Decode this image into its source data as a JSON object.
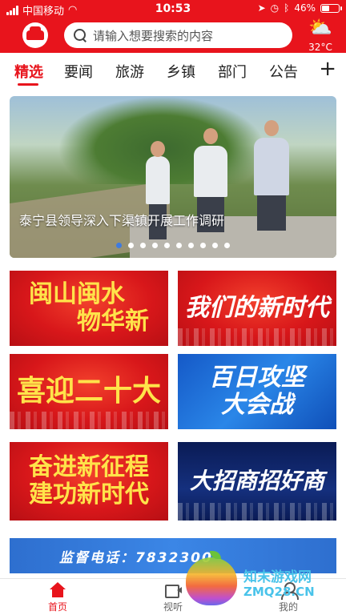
{
  "status_bar": {
    "carrier": "中国移动",
    "time": "10:53",
    "battery": "46%",
    "battery_level": 0.46
  },
  "header": {
    "search_placeholder": "请输入想要搜索的内容",
    "weather_temp": "32°C",
    "weather_icon": "partly-cloudy-icon"
  },
  "tabs": [
    "精选",
    "要闻",
    "旅游",
    "乡镇",
    "部门",
    "公告"
  ],
  "tab_plus": "+",
  "banner": {
    "caption": "泰宁县领导深入下渠镇开展工作调研",
    "dot_count": 10,
    "active_dot": 0
  },
  "tiles": [
    {
      "line1": "闽山闽水",
      "line2": "物华新"
    },
    {
      "line1": "我们的新时代",
      "line2": ""
    },
    {
      "line1": "喜迎二十大",
      "line2": ""
    },
    {
      "line1": "百日攻坚",
      "line2": "大会战"
    },
    {
      "line1": "奋进新征程",
      "line2": "建功新时代"
    },
    {
      "line1": "大招商招好商",
      "line2": ""
    }
  ],
  "hotline": "监督电话：7832300",
  "bottom_nav": [
    {
      "label": "首页",
      "icon": "home-icon"
    },
    {
      "label": "视听",
      "icon": "video-icon"
    },
    {
      "label": "我的",
      "icon": "user-icon"
    }
  ],
  "watermark": {
    "line1": "知末游戏网",
    "line2": "ZMQ28.CN"
  },
  "colors": {
    "brand_red": "#e8141c",
    "active_dot": "#3f7be0"
  }
}
